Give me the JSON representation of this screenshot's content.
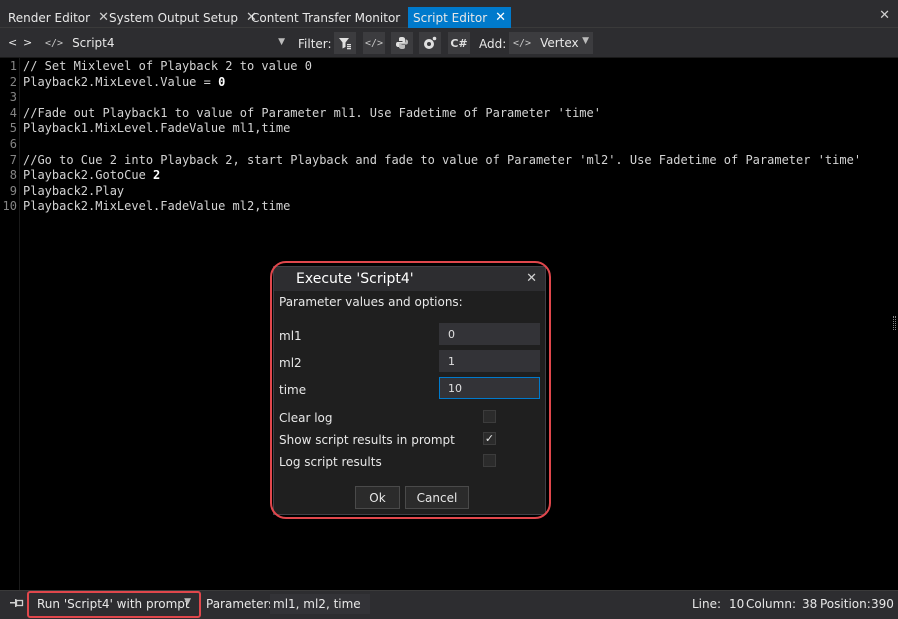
{
  "tabs": [
    {
      "label": "Render Editor",
      "active": false
    },
    {
      "label": "System Output Setup",
      "active": false
    },
    {
      "label": "Content Transfer Monitor",
      "active": false
    },
    {
      "label": "Script Editor",
      "active": true
    }
  ],
  "tab_close_glyph": "✕",
  "toolbar": {
    "back": "<",
    "forward": ">",
    "script_name": "Script4",
    "filter_label": "Filter:",
    "filter_buttons": [
      "filter-icon",
      "code-icon",
      "python-icon",
      "node-icon",
      "csharp-icon"
    ],
    "csharp_text": "C#",
    "add_label": "Add:",
    "add_value": "Vertex"
  },
  "code_lines": [
    {
      "n": "1",
      "text": "// Set Mixlevel of Playback 2 to value 0",
      "bold": ""
    },
    {
      "n": "2",
      "text": "Playback2.MixLevel.Value = ",
      "bold": "0"
    },
    {
      "n": "3",
      "text": "",
      "bold": ""
    },
    {
      "n": "4",
      "text": "//Fade out Playback1 to value of Parameter ml1. Use Fadetime of Parameter 'time'",
      "bold": ""
    },
    {
      "n": "5",
      "text": "Playback1.MixLevel.FadeValue ml1,time",
      "bold": ""
    },
    {
      "n": "6",
      "text": "",
      "bold": ""
    },
    {
      "n": "7",
      "text": "//Go to Cue 2 into Playback 2, start Playback and fade to value of Parameter 'ml2'. Use Fadetime of Parameter 'time'",
      "bold": ""
    },
    {
      "n": "8",
      "text": "Playback2.GotoCue ",
      "bold": "2"
    },
    {
      "n": "9",
      "text": "Playback2.Play",
      "bold": ""
    },
    {
      "n": "10",
      "text": "Playback2.MixLevel.FadeValue ml2,time",
      "bold": ""
    }
  ],
  "dialog": {
    "title": "Execute 'Script4'",
    "subtitle": "Parameter values and options:",
    "params": [
      {
        "label": "ml1",
        "value": "0"
      },
      {
        "label": "ml2",
        "value": "1"
      },
      {
        "label": "time",
        "value": "10"
      }
    ],
    "options": [
      {
        "label": "Clear log",
        "checked": false
      },
      {
        "label": "Show script results in prompt",
        "checked": true
      },
      {
        "label": "Log script results",
        "checked": false
      }
    ],
    "ok_label": "Ok",
    "cancel_label": "Cancel"
  },
  "statusbar": {
    "run_label": "Run 'Script4' with prompt",
    "params_label": "Parameters:",
    "params_value": "ml1, ml2, time",
    "line_label": "Line:",
    "line_value": "10",
    "column_label": "Column:",
    "column_value": "38",
    "position_label": "Position:",
    "position_value": "390"
  },
  "colors": {
    "accent": "#007acc",
    "highlight": "#e0474c",
    "editor_bg": "#000000",
    "chrome_bg": "#2d2d30"
  }
}
